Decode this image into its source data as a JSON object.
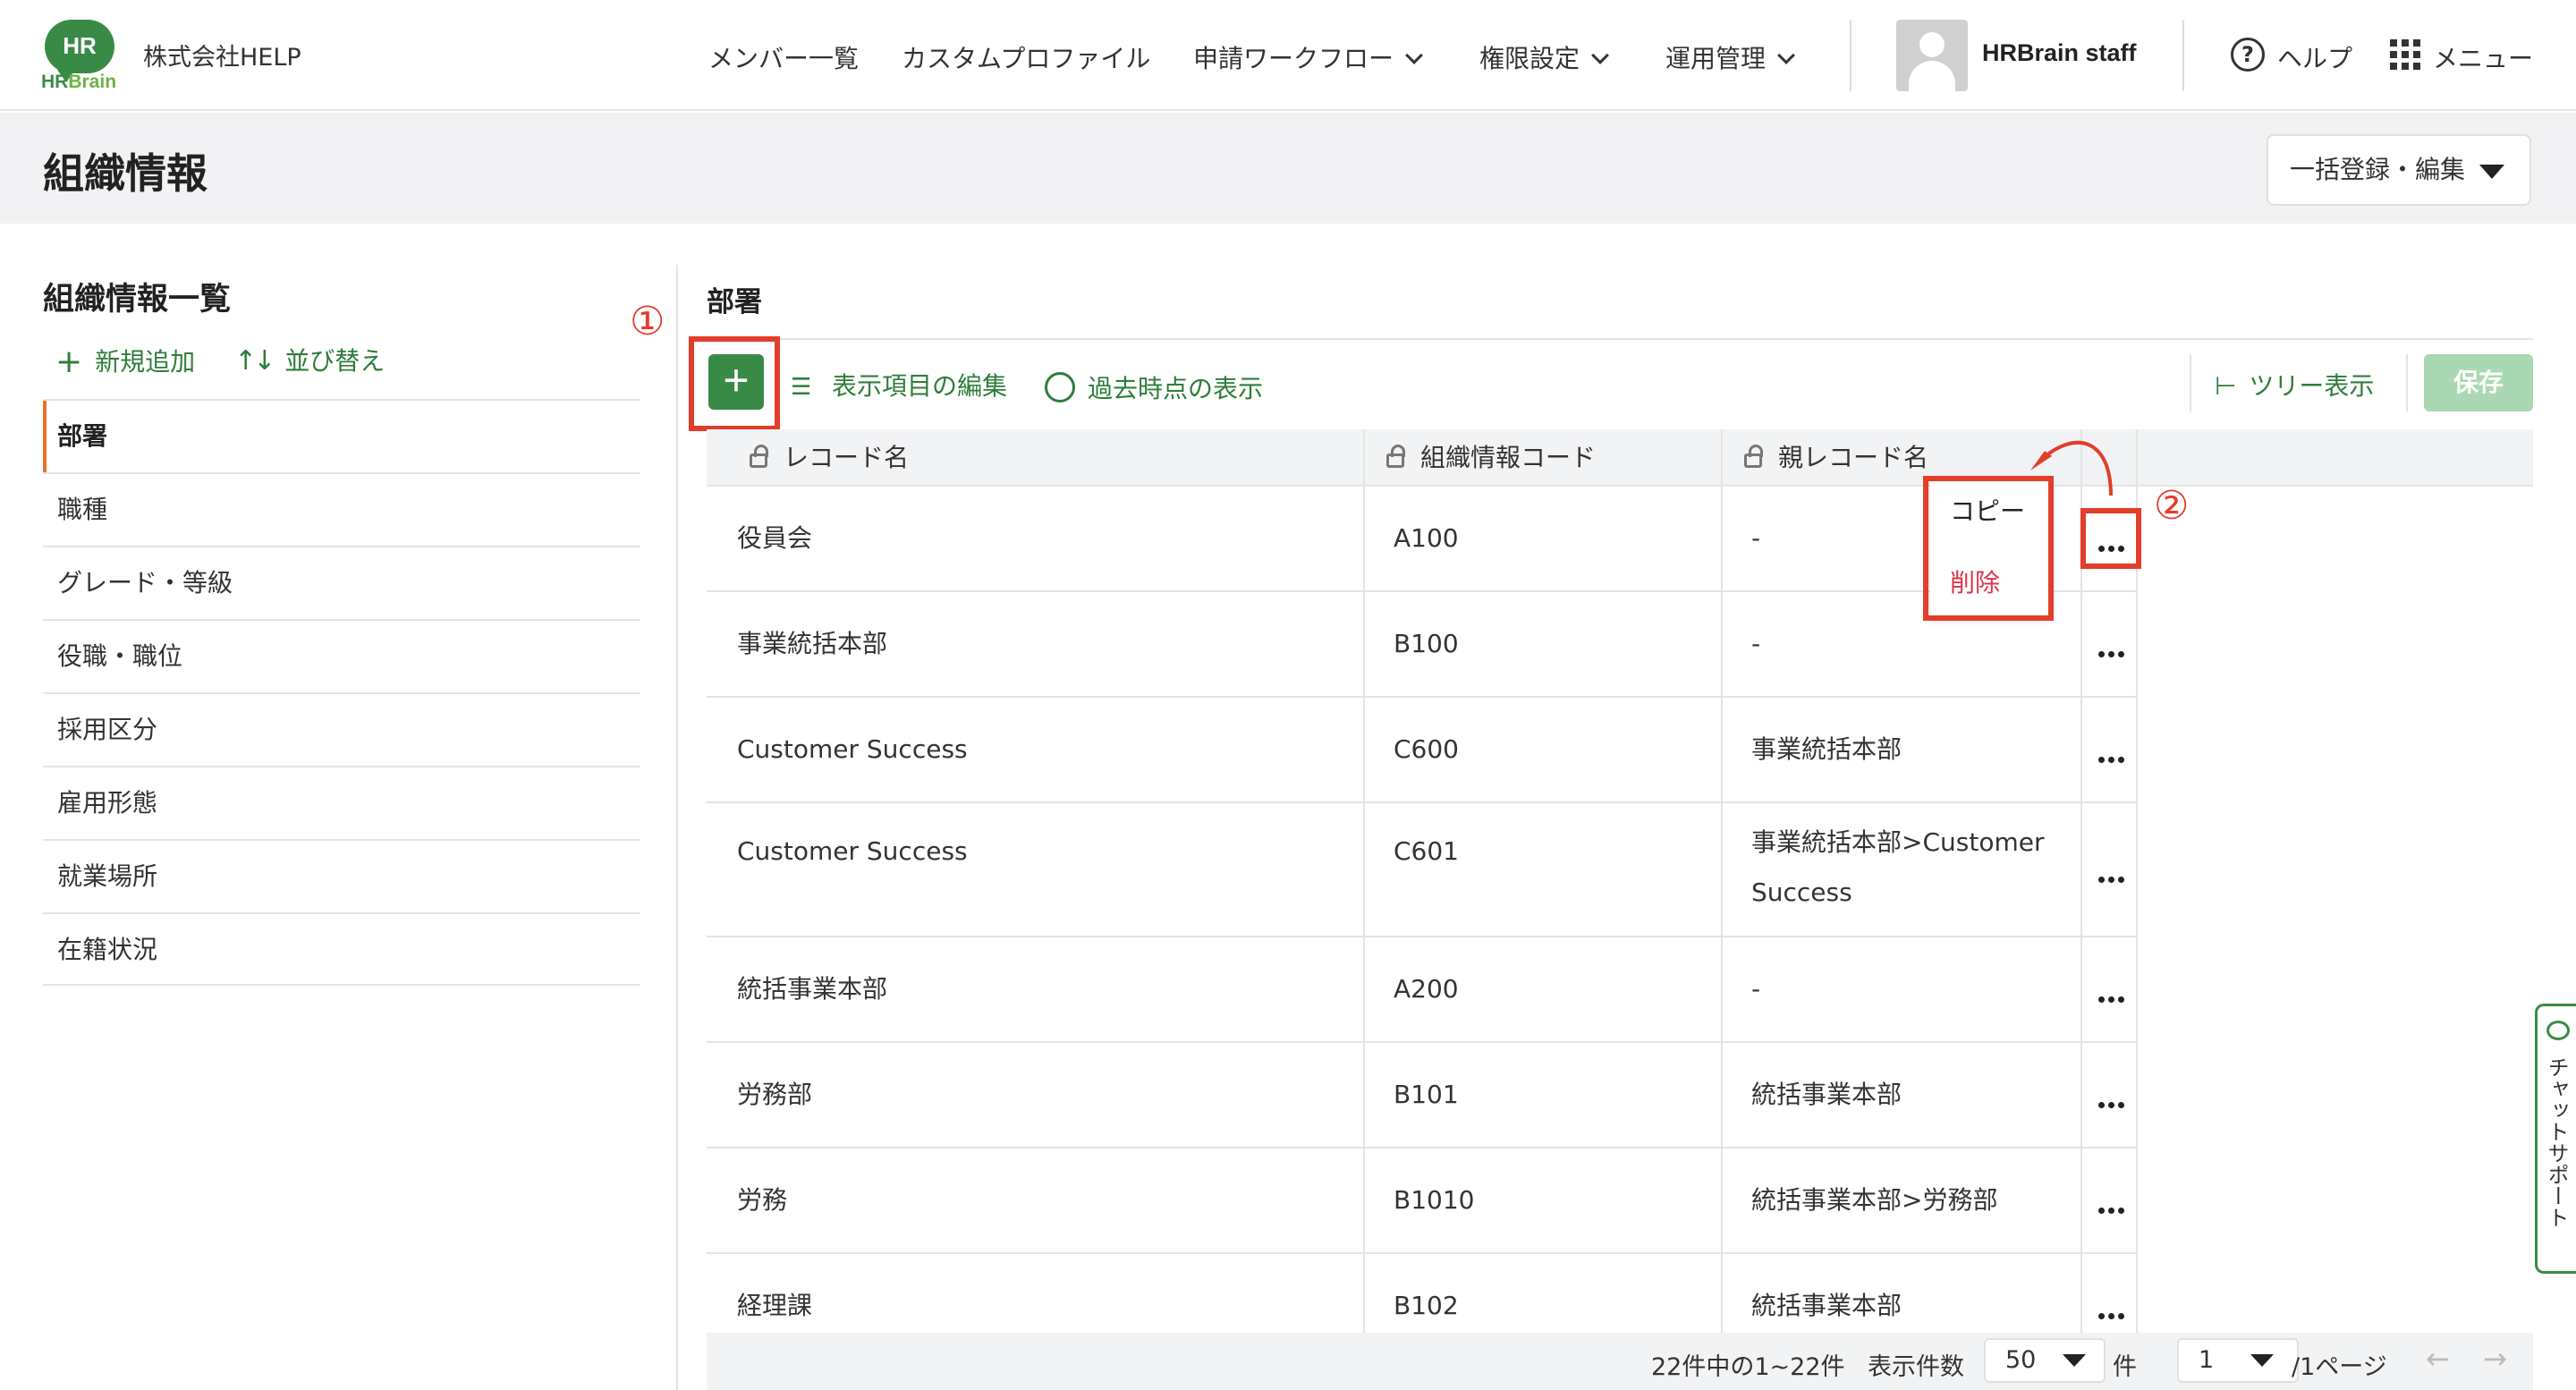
{
  "header": {
    "logo_mark": "HR",
    "logo_word_a": "HR",
    "logo_word_b": "Brain",
    "company": "株式会社HELP",
    "nav": [
      "メンバー一覧",
      "カスタムプロファイル",
      "申請ワークフロー",
      "権限設定",
      "運用管理"
    ],
    "user": "HRBrain staff",
    "help_glyph": "?",
    "help": "ヘルプ",
    "menu": "メニュー"
  },
  "page": {
    "title": "組織情報",
    "bulk_button": "一括登録・編集"
  },
  "sidebar": {
    "title": "組織情報一覧",
    "add_new": "新規追加",
    "sort": "並び替え",
    "items": [
      "部署",
      "職種",
      "グレード・等級",
      "役職・職位",
      "採用区分",
      "雇用形態",
      "就業場所",
      "在籍状況"
    ],
    "active_index": 0
  },
  "main": {
    "section_title": "部署",
    "edit_columns": "表示項目の編集",
    "past_view": "過去時点の表示",
    "tree_view": "ツリー表示",
    "save": "保存",
    "add_glyph": "+"
  },
  "table": {
    "columns": [
      "レコード名",
      "組織情報コード",
      "親レコード名"
    ],
    "rows": [
      {
        "name": "役員会",
        "code": "A100",
        "parent": "-"
      },
      {
        "name": "事業統括本部",
        "code": "B100",
        "parent": "-"
      },
      {
        "name": "Customer Success",
        "code": "C600",
        "parent": "事業統括本部"
      },
      {
        "name": "Customer Success",
        "code": "C601",
        "parent": "事業統括本部>Customer Success"
      },
      {
        "name": "統括事業本部",
        "code": "A200",
        "parent": "-"
      },
      {
        "name": "労務部",
        "code": "B101",
        "parent": "統括事業本部"
      },
      {
        "name": "労務",
        "code": "B1010",
        "parent": "統括事業本部>労務部"
      },
      {
        "name": "経理課",
        "code": "B102",
        "parent": "統括事業本部"
      }
    ]
  },
  "row_menu": {
    "copy": "コピー",
    "delete": "削除"
  },
  "annotations": {
    "step1": "①",
    "step2": "②"
  },
  "footer": {
    "range": "22件中の1~22件",
    "per_page_label": "表示件数",
    "per_page_value": "50",
    "per_page_unit": "件",
    "page_value": "1",
    "page_total": "/1ページ"
  },
  "chat_support": "チャットサポート",
  "colors": {
    "brand_green": "#3a8a47",
    "accent_orange": "#e8742a",
    "annotation_red": "#e33d2b",
    "delete_red": "#d9364a"
  }
}
